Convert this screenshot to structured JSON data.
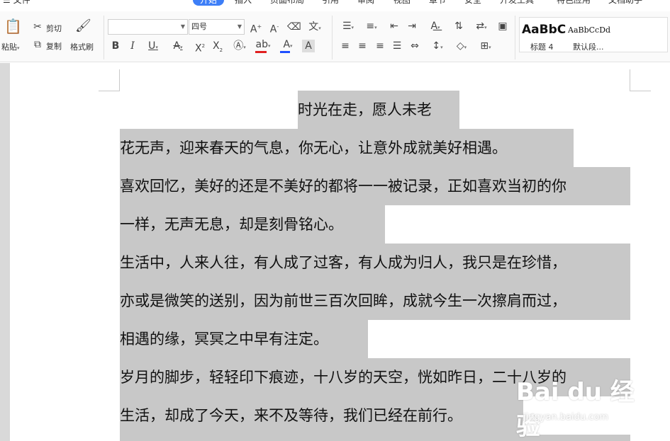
{
  "menu": {
    "items": [
      "文件",
      "开始",
      "插入",
      "页面布局",
      "引用",
      "审阅",
      "视图",
      "章节",
      "安全",
      "开发工具",
      "特色应用",
      "文档助手"
    ]
  },
  "ribbon": {
    "paste": "粘贴",
    "cut": "剪切",
    "copy": "复制",
    "format_painter": "格式刷",
    "font_name": "",
    "font_size": "四号",
    "styles": {
      "sample_heading": "AaBbC",
      "sample_normal": "AaBbCcDd",
      "heading_label": "标题 4",
      "normal_label": "默认段..."
    }
  },
  "document": {
    "title": "时光在走，愿人未老",
    "lines": [
      "花无声，迎来春天的气息，你无心，让意外成就美好相遇。",
      "喜欢回忆，美好的还是不美好的都将一一被记录，正如喜欢当初的你",
      "一样，无声无息，却是刻骨铭心。",
      "生活中，人来人往，有人成了过客，有人成为归人，我只是在珍惜，",
      "亦或是微笑的送别，因为前世三百次回眸，成就今生一次擦肩而过，",
      "相遇的缘，冥冥之中早有注定。",
      "岁月的脚步，轻轻印下痕迹，十八岁的天空，恍如昨日，二十八岁的",
      "生活，却成了今天，来不及等待，我们已经在前行。"
    ]
  },
  "watermark": {
    "logo": "Bai du 经验",
    "url": "jingyan.baidu.com"
  },
  "colors": {
    "accent": "#3d7ef7",
    "selection": "#c8c8c8",
    "font_color_bar": "#1f4fff",
    "highlight_bar": "#e02020"
  }
}
